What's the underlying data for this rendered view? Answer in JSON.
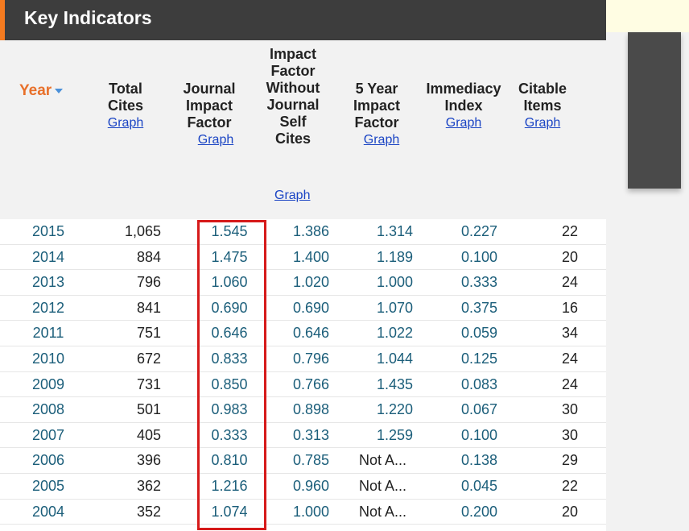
{
  "title": "Key Indicators",
  "columns": {
    "year": "Year",
    "total_cites": {
      "line1": "Total",
      "line2": "Cites",
      "link": "Graph"
    },
    "jif": {
      "line1": "Journal",
      "line2": "Impact",
      "line3": "Factor",
      "link": "Graph"
    },
    "jif_wo": {
      "line1": "Impact",
      "line2": "Factor",
      "line3": "Without",
      "line4": "Journal",
      "line5": "Self",
      "line6": "Cites",
      "link": "Graph"
    },
    "five_year": {
      "line1": "5 Year",
      "line2": "Impact",
      "line3": "Factor",
      "link": "Graph"
    },
    "immediacy": {
      "line1": "Immediacy",
      "line2": "Index",
      "link": "Graph"
    },
    "citable": {
      "line1": "Citable",
      "line2": "Items",
      "link": "Graph"
    }
  },
  "rows": [
    {
      "year": "2015",
      "total_cites": "1,065",
      "jif": "1.545",
      "jif_wo": "1.386",
      "five_year": "1.314",
      "immediacy": "0.227",
      "citable": "22"
    },
    {
      "year": "2014",
      "total_cites": "884",
      "jif": "1.475",
      "jif_wo": "1.400",
      "five_year": "1.189",
      "immediacy": "0.100",
      "citable": "20"
    },
    {
      "year": "2013",
      "total_cites": "796",
      "jif": "1.060",
      "jif_wo": "1.020",
      "five_year": "1.000",
      "immediacy": "0.333",
      "citable": "24"
    },
    {
      "year": "2012",
      "total_cites": "841",
      "jif": "0.690",
      "jif_wo": "0.690",
      "five_year": "1.070",
      "immediacy": "0.375",
      "citable": "16"
    },
    {
      "year": "2011",
      "total_cites": "751",
      "jif": "0.646",
      "jif_wo": "0.646",
      "five_year": "1.022",
      "immediacy": "0.059",
      "citable": "34"
    },
    {
      "year": "2010",
      "total_cites": "672",
      "jif": "0.833",
      "jif_wo": "0.796",
      "five_year": "1.044",
      "immediacy": "0.125",
      "citable": "24"
    },
    {
      "year": "2009",
      "total_cites": "731",
      "jif": "0.850",
      "jif_wo": "0.766",
      "five_year": "1.435",
      "immediacy": "0.083",
      "citable": "24"
    },
    {
      "year": "2008",
      "total_cites": "501",
      "jif": "0.983",
      "jif_wo": "0.898",
      "five_year": "1.220",
      "immediacy": "0.067",
      "citable": "30"
    },
    {
      "year": "2007",
      "total_cites": "405",
      "jif": "0.333",
      "jif_wo": "0.313",
      "five_year": "1.259",
      "immediacy": "0.100",
      "citable": "30"
    },
    {
      "year": "2006",
      "total_cites": "396",
      "jif": "0.810",
      "jif_wo": "0.785",
      "five_year": "Not A...",
      "immediacy": "0.138",
      "citable": "29"
    },
    {
      "year": "2005",
      "total_cites": "362",
      "jif": "1.216",
      "jif_wo": "0.960",
      "five_year": "Not A...",
      "immediacy": "0.045",
      "citable": "22"
    },
    {
      "year": "2004",
      "total_cites": "352",
      "jif": "1.074",
      "jif_wo": "1.000",
      "five_year": "Not A...",
      "immediacy": "0.200",
      "citable": "20"
    }
  ],
  "colors": {
    "accent": "#f47b20",
    "title_bg": "#3d3d3d",
    "link": "#1a44c4",
    "highlight": "#d61a1a",
    "value_text": "#1b5e7a"
  }
}
